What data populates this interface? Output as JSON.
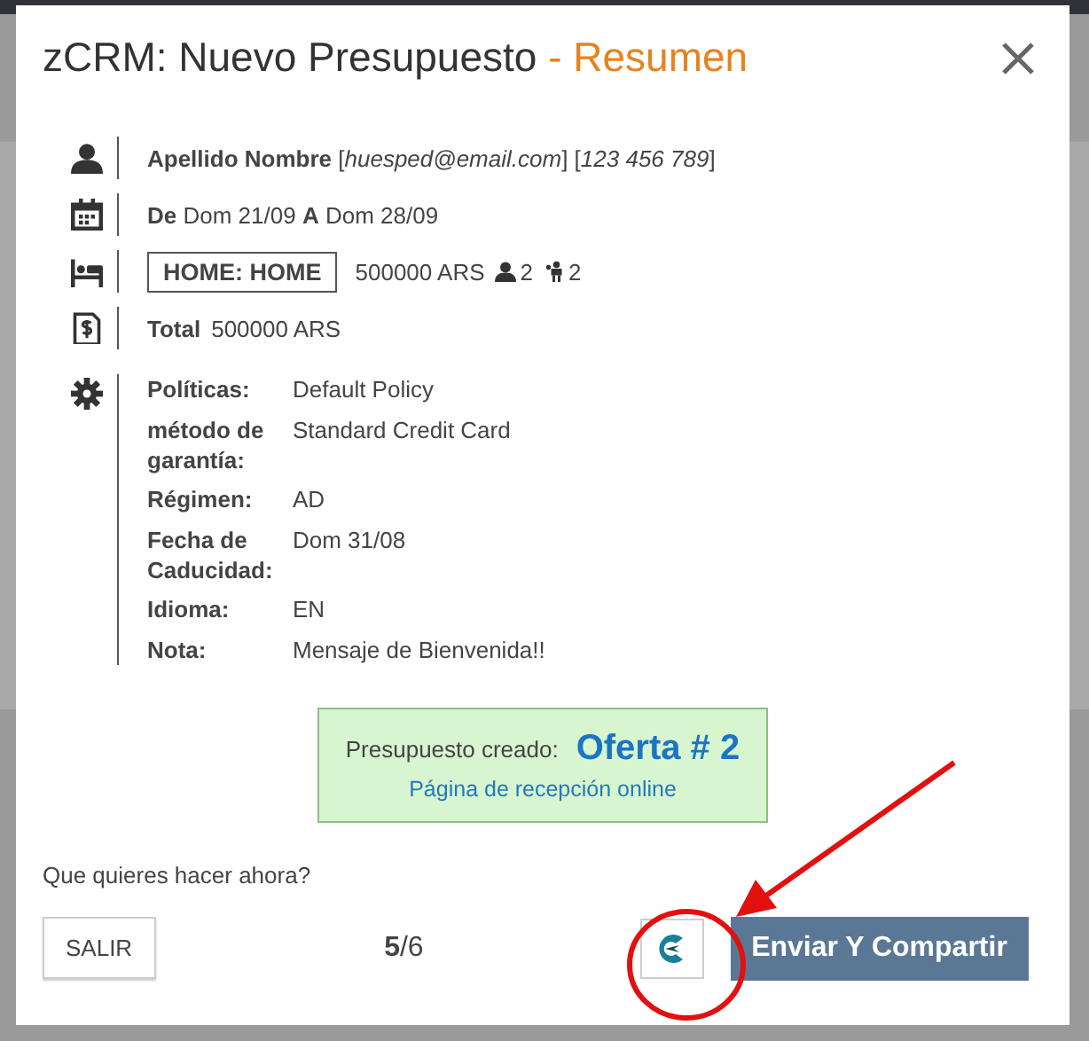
{
  "dialog": {
    "title": "zCRM: Nuevo Presupuesto",
    "title_suffix": "- Resumen"
  },
  "summary": [
    {
      "kind": "guest",
      "text": "**Apellido Nombre** [*huesped@email.com*] [*123 456 789*]"
    },
    {
      "kind": "dates",
      "text": "**De** Dom 21/09 **A** Dom 28/09"
    },
    {
      "kind": "room",
      "room": "HOME: HOME",
      "price": "500000 ARS",
      "adults": "2",
      "children": "2"
    },
    {
      "kind": "total",
      "label": "Total",
      "value": "500000 ARS"
    },
    {
      "kind": "details",
      "items": [
        {
          "label": "Políticas:",
          "value": "Default Policy"
        },
        {
          "label": "método de garantía:",
          "value": "Standard Credit Card"
        },
        {
          "label": "Régimen:",
          "value": "AD"
        },
        {
          "label": "Fecha de Caducidad:",
          "value": "Dom 31/08"
        },
        {
          "label": "Idioma:",
          "value": "EN"
        },
        {
          "label": "Nota:",
          "value": "Mensaje de Bienvenida!!"
        }
      ]
    }
  ],
  "offer": {
    "label": "Presupuesto creado:",
    "number": "Oferta # 2",
    "link": "Página de recepción online"
  },
  "prompt": "Que quieres hacer ahora?",
  "footer": {
    "exit": "SALIR",
    "step": "**5**/6",
    "send": "Enviar Y Compartir"
  },
  "annotation": {
    "kind": "arrow-circle"
  }
}
